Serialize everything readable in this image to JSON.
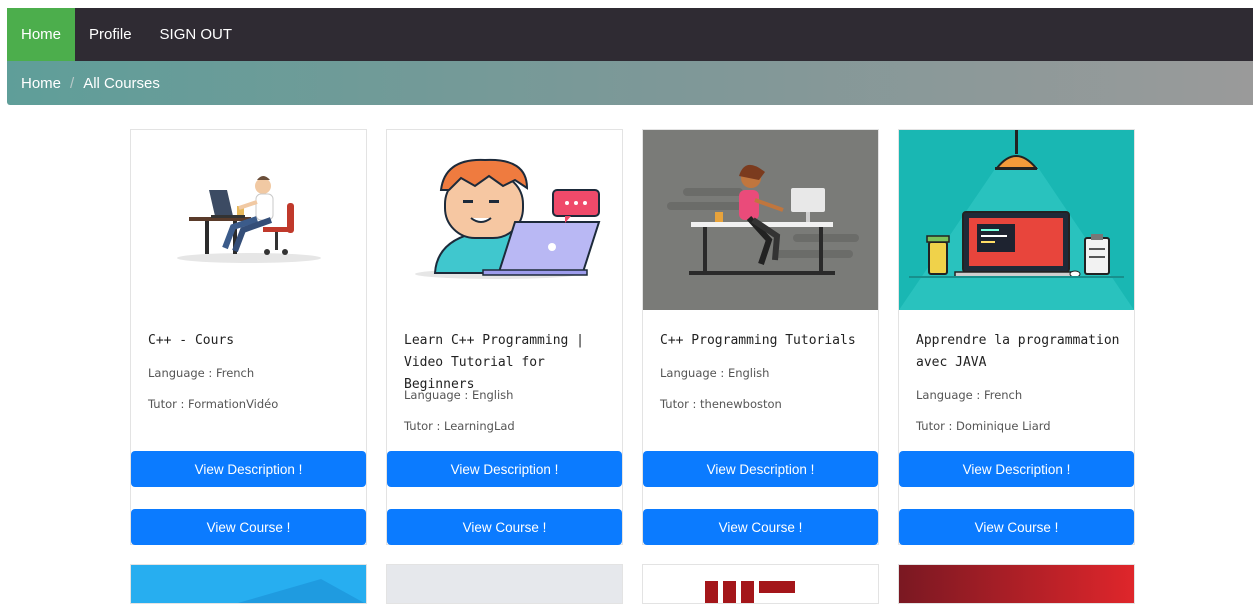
{
  "nav": {
    "home": "Home",
    "profile": "Profile",
    "signout": "SIGN OUT"
  },
  "breadcrumb": {
    "home": "Home",
    "current": "All Courses"
  },
  "cards": [
    {
      "title": "C++ - Cours",
      "language": "Language : French",
      "tutor": "Tutor : FormationVidéo",
      "desc_btn": "View Description !",
      "course_btn": "View Course !"
    },
    {
      "title": "Learn C++ Programming | Video Tutorial for Beginners",
      "language": "Language : English",
      "tutor": "Tutor : LearningLad",
      "desc_btn": "View Description !",
      "course_btn": "View Course !"
    },
    {
      "title": "C++ Programming Tutorials",
      "language": "Language : English",
      "tutor": "Tutor : thenewboston",
      "desc_btn": "View Description !",
      "course_btn": "View Course !"
    },
    {
      "title": "Apprendre la programmation avec JAVA",
      "language": "Language : French",
      "tutor": "Tutor : Dominique Liard",
      "desc_btn": "View Description !",
      "course_btn": "View Course !"
    }
  ],
  "colors": {
    "nav_bg": "#2f2b33",
    "active": "#4cae4c",
    "button": "#0b7bff"
  }
}
